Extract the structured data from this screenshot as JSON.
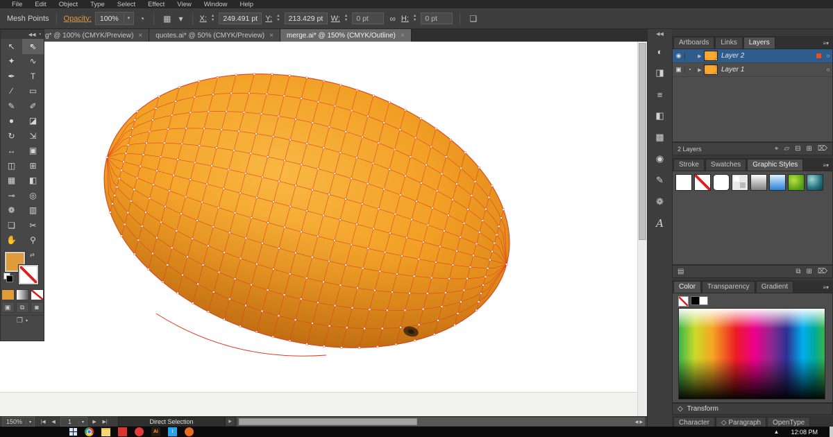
{
  "menubar": {
    "items": [
      "File",
      "Edit",
      "Object",
      "Type",
      "Select",
      "Effect",
      "View",
      "Window",
      "Help"
    ]
  },
  "controlbar": {
    "context_label": "Mesh Points",
    "opacity_label": "Opacity:",
    "opacity_value": "100%",
    "x_label": "X:",
    "x_value": "249.491 pt",
    "y_label": "Y:",
    "y_value": "213.429 pt",
    "w_label": "W:",
    "w_value": "0 pt",
    "h_label": "H:",
    "h_value": "0 pt",
    "link_glyph": "∞",
    "recolor_glyph": "◔",
    "options_glyph": "▦",
    "bounds_glyph": "❏"
  },
  "tabbar": {
    "close_glyph": "×",
    "tabs": [
      {
        "name": "doc-tab-g",
        "title": "g* @ 100% (CMYK/Preview)"
      },
      {
        "name": "doc-tab-quotes",
        "title": "quotes.ai* @ 50% (CMYK/Preview)"
      },
      {
        "name": "doc-tab-merge",
        "title": "merge.ai* @ 150% (CMYK/Outline)",
        "active": true
      }
    ]
  },
  "toolbar": {
    "tools": [
      {
        "name": "selection-tool",
        "glyph": "↖"
      },
      {
        "name": "direct-selection-tool",
        "glyph": "⇖",
        "active": true
      },
      {
        "name": "magic-wand-tool",
        "glyph": "✦"
      },
      {
        "name": "lasso-tool",
        "glyph": "∿"
      },
      {
        "name": "pen-tool",
        "glyph": "✒"
      },
      {
        "name": "type-tool",
        "glyph": "T"
      },
      {
        "name": "line-segment-tool",
        "glyph": "∕"
      },
      {
        "name": "rectangle-tool",
        "glyph": "▭"
      },
      {
        "name": "paintbrush-tool",
        "glyph": "✎"
      },
      {
        "name": "pencil-tool",
        "glyph": "✐"
      },
      {
        "name": "blob-brush-tool",
        "glyph": "●"
      },
      {
        "name": "eraser-tool",
        "glyph": "◪"
      },
      {
        "name": "rotate-tool",
        "glyph": "↻"
      },
      {
        "name": "scale-tool",
        "glyph": "⇲"
      },
      {
        "name": "width-tool",
        "glyph": "↔"
      },
      {
        "name": "free-transform-tool",
        "glyph": "▣"
      },
      {
        "name": "shape-builder-tool",
        "glyph": "◫"
      },
      {
        "name": "perspective-grid-tool",
        "glyph": "⊞"
      },
      {
        "name": "mesh-tool",
        "glyph": "▦"
      },
      {
        "name": "gradient-tool",
        "glyph": "◧"
      },
      {
        "name": "eyedropper-tool",
        "glyph": "⊸"
      },
      {
        "name": "blend-tool",
        "glyph": "◎"
      },
      {
        "name": "symbol-sprayer-tool",
        "glyph": "❁"
      },
      {
        "name": "column-graph-tool",
        "glyph": "▥"
      },
      {
        "name": "artboard-tool",
        "glyph": "❏"
      },
      {
        "name": "slice-tool",
        "glyph": "✂"
      },
      {
        "name": "hand-tool",
        "glyph": "✋"
      },
      {
        "name": "zoom-tool",
        "glyph": "⚲"
      }
    ],
    "draw_modes": [
      {
        "name": "draw-normal-icon",
        "glyph": "▣"
      },
      {
        "name": "draw-behind-icon",
        "glyph": "⧉"
      },
      {
        "name": "draw-inside-icon",
        "glyph": "◙"
      }
    ],
    "screen_mode_glyph": "❐"
  },
  "dockstrip": {
    "icons": [
      {
        "name": "color-panel-icon",
        "glyph": "◐"
      },
      {
        "name": "color-guide-panel-icon",
        "glyph": "◨"
      },
      {
        "name": "stroke-panel-icon",
        "glyph": "≡"
      },
      {
        "name": "gradient-panel-icon",
        "glyph": "◧"
      },
      {
        "name": "transparency-panel-icon",
        "glyph": "▩"
      },
      {
        "name": "appearance-panel-icon",
        "glyph": "◉"
      },
      {
        "name": "brushes-panel-icon",
        "glyph": "✎"
      },
      {
        "name": "symbols-panel-icon",
        "glyph": "❁"
      },
      {
        "name": "character-panel-icon",
        "glyph": "A",
        "cls": "script"
      }
    ]
  },
  "panels": {
    "layers": {
      "tabs": [
        {
          "name": "tab-artboards",
          "label": "Artboards"
        },
        {
          "name": "tab-links",
          "label": "Links"
        },
        {
          "name": "tab-layers",
          "label": "Layers",
          "active": true
        }
      ],
      "rows": [
        {
          "name": "layer-row-2",
          "label": "Layer 2",
          "vis": "◉",
          "lock": "",
          "selected": true,
          "chip": "#e8501e"
        },
        {
          "name": "layer-row-1",
          "label": "Layer 1",
          "vis": "▣",
          "lock": "▪",
          "chip": ""
        }
      ],
      "count_text": "2 Layers",
      "footer_icons": [
        {
          "name": "locate-object-icon",
          "glyph": "⌖"
        },
        {
          "name": "make-mask-icon",
          "glyph": "▱"
        },
        {
          "name": "new-sublayer-icon",
          "glyph": "⊟"
        },
        {
          "name": "new-layer-icon",
          "glyph": "⊞"
        },
        {
          "name": "delete-layer-icon",
          "glyph": "⌦"
        }
      ]
    },
    "styles": {
      "tabs": [
        {
          "name": "tab-stroke",
          "label": "Stroke"
        },
        {
          "name": "tab-swatches",
          "label": "Swatches"
        },
        {
          "name": "tab-graphic-styles",
          "label": "Graphic Styles",
          "active": true
        }
      ],
      "thumbs": [
        {
          "name": "style-default",
          "cls": "thumb-plain"
        },
        {
          "name": "style-none",
          "cls": "thumb-none"
        },
        {
          "name": "style-rounded",
          "cls": "thumb-round"
        },
        {
          "name": "style-pair",
          "cls": "thumb-pair"
        },
        {
          "name": "style-gray-gradient",
          "cls": "thumb-gray"
        },
        {
          "name": "style-blue-gradient",
          "cls": "thumb-blue"
        },
        {
          "name": "style-green",
          "cls": "thumb-green"
        },
        {
          "name": "style-texture",
          "cls": "thumb-teal"
        }
      ],
      "libraries_glyph": "▤",
      "footer_icons": [
        {
          "name": "break-link-style-icon",
          "glyph": "⧉"
        },
        {
          "name": "new-style-icon",
          "glyph": "⊞"
        },
        {
          "name": "delete-style-icon",
          "glyph": "⌦"
        }
      ]
    },
    "color": {
      "tabs": [
        {
          "name": "tab-color",
          "label": "Color",
          "active": true
        },
        {
          "name": "tab-transparency",
          "label": "Transparency"
        },
        {
          "name": "tab-gradient",
          "label": "Gradient"
        }
      ]
    },
    "transform_label": "Transform",
    "transform_glyph": "◇",
    "type_tabs": [
      {
        "name": "tab-character",
        "label": "Character",
        "icon": ""
      },
      {
        "name": "tab-paragraph",
        "label": "Paragraph",
        "icon": "◇"
      },
      {
        "name": "tab-opentype",
        "label": "OpenType",
        "icon": ""
      }
    ]
  },
  "statusbar": {
    "zoom": "150%",
    "page": "1",
    "tool_label": "Direct Selection",
    "first_glyph": "|◀",
    "prev_glyph": "◀",
    "next_glyph": "▶",
    "last_glyph": "▶|",
    "dropdown_glyph": "▾",
    "flyout_glyph": "▶",
    "scroll_left_glyph": "◀",
    "scroll_right_glyph": "▶"
  },
  "taskbar": {
    "clock": "12:08 PM",
    "tray_glyph": "▲",
    "icons": [
      {
        "name": "chrome-icon",
        "cls": "chrome",
        "glyph": ""
      },
      {
        "name": "folder-icon",
        "cls": "folder",
        "glyph": ""
      },
      {
        "name": "media-player-icon",
        "cls": "redsq",
        "glyph": ""
      },
      {
        "name": "opera-icon",
        "cls": "opera",
        "glyph": ""
      },
      {
        "name": "illustrator-icon",
        "cls": "ai",
        "glyph": "Ai"
      },
      {
        "name": "twitter-icon",
        "cls": "twitter",
        "glyph": "t"
      },
      {
        "name": "firefox-icon",
        "cls": "firefox",
        "glyph": ""
      }
    ]
  },
  "glyphs": {
    "collapse": "◀◀",
    "panel_menu": "≡▾",
    "expand": "▶",
    "swap": "⇄",
    "target": "○",
    "dot": "▪",
    "combo_arrow": "▾",
    "up": "▲",
    "down": "▼"
  },
  "colors": {
    "fill_orange": "#e09c3a",
    "selection_blue": "#2e5c8c",
    "mesh_red": "#e04120"
  }
}
